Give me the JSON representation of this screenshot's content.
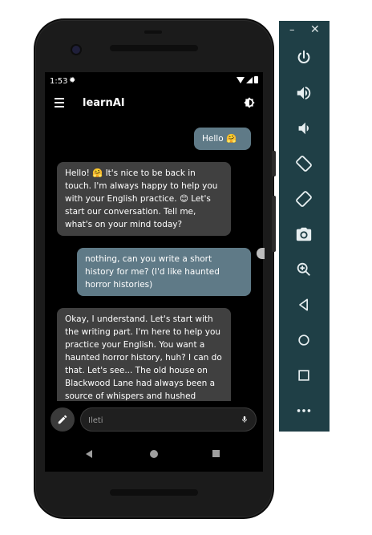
{
  "status": {
    "time": "1:53"
  },
  "app": {
    "title": "learnAI"
  },
  "messages": [
    {
      "role": "user",
      "text": "Hello 🤗"
    },
    {
      "role": "assistant",
      "text": "Hello! 🤗 It's nice to be back in touch. I'm always happy to help you with your English practice. 😊 Let's start our conversation. Tell me, what's on your mind today?"
    },
    {
      "role": "user",
      "text": "nothing, can you write a short history for me? (I'd like haunted horror histories)"
    },
    {
      "role": "assistant",
      "text": "Okay, I understand. Let's start with the writing part. I'm here to help you practice your English. You want a haunted horror history, huh? I can do that. Let's see... The old house on Blackwood Lane had always been a source of whispers and hushed"
    }
  ],
  "composer": {
    "placeholder": "İleti"
  },
  "panel": {
    "minimize": "–",
    "close": "✕"
  },
  "colors": {
    "user_bubble": "#5f7a87",
    "bot_bubble": "#404040",
    "panel_bg": "#1f3f46"
  },
  "icons": [
    "menu-icon",
    "brightness-icon",
    "pen-icon",
    "mic-icon",
    "power-icon",
    "volume-up-icon",
    "volume-down-icon",
    "rotate-left-icon",
    "rotate-right-icon",
    "camera-icon",
    "zoom-icon",
    "back-icon",
    "home-icon",
    "overview-icon",
    "more-icon"
  ]
}
